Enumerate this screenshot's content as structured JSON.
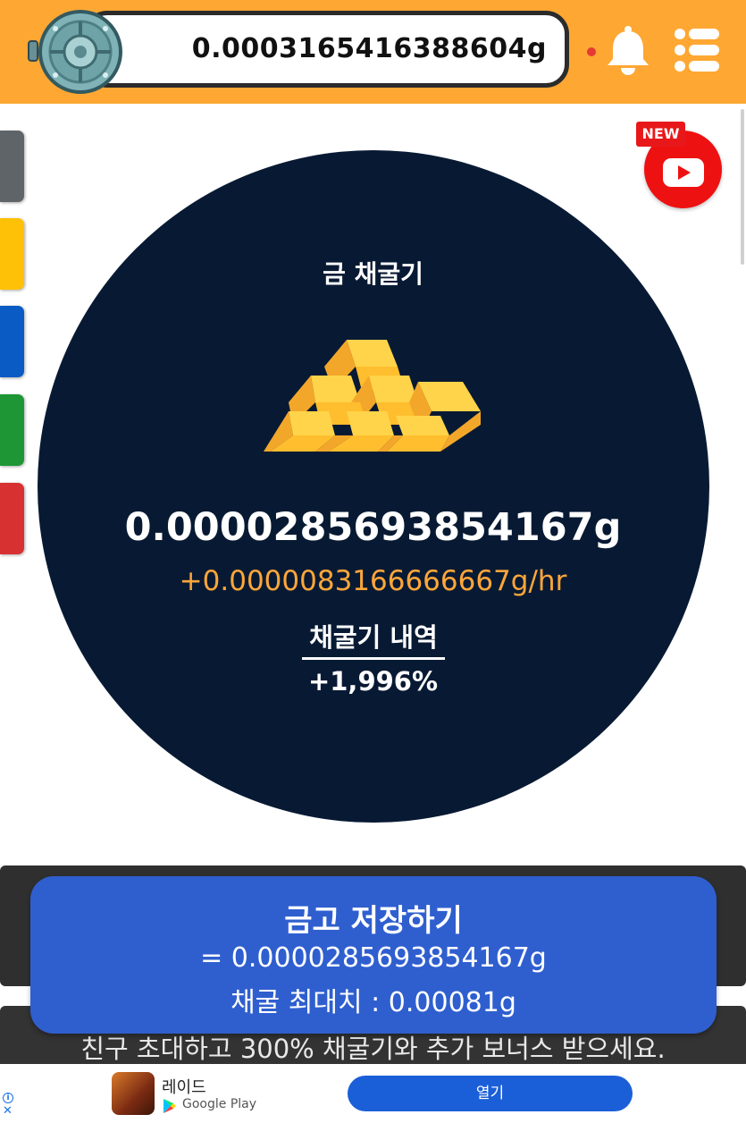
{
  "header": {
    "balance": "0.0003165416388604g"
  },
  "youtube": {
    "badge": "NEW"
  },
  "miner": {
    "title": "금 채굴기",
    "mined_amount": "0.0000285693854167g",
    "rate": "+0.0000083166666667g/hr",
    "history_label": "채굴기 내역",
    "boost": "+1,996%"
  },
  "save_card": {
    "title": "금고 저장하기",
    "amount": "= 0.0000285693854167g",
    "max": "채굴 최대치 : 0.00081g"
  },
  "invite": {
    "text": "친구 초대하고 300% 채굴기와 추가 보너스 받으세요."
  },
  "ad": {
    "app_name": "레이드",
    "store": "Google Play",
    "open_label": "열기"
  },
  "colors": {
    "header_bg": "#FFA733",
    "circle_bg": "#081a33",
    "rate_orange": "#FFA63A",
    "save_card_blue": "#2F5FCF",
    "side_tabs": [
      "#5f6468",
      "#FFC107",
      "#0a5bc4",
      "#1e9636",
      "#d83131"
    ]
  },
  "icons": [
    "vault-icon",
    "bell-icon",
    "menu-icon",
    "youtube-icon",
    "gold-bars-icon",
    "google-play-icon"
  ]
}
